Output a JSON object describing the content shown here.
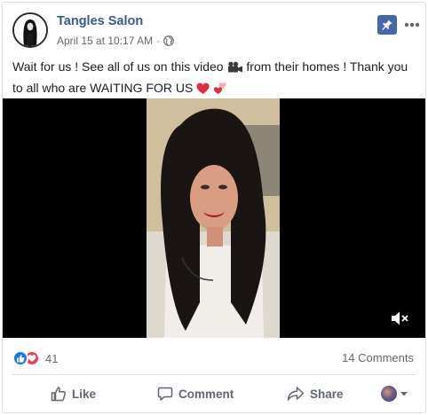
{
  "post": {
    "page_name": "Tangles Salon",
    "date": "April 15 at 10:17 AM",
    "separator": "·",
    "message": {
      "part1": "Wait for us ! See all of us on this video",
      "part2": "from their homes ! Thank you to all who are WAITING FOR US"
    }
  },
  "stats": {
    "reaction_count": "41",
    "comments": "14 Comments"
  },
  "actions": {
    "like": "Like",
    "comment": "Comment",
    "share": "Share"
  },
  "colors": {
    "brand": "#385898",
    "pin": "#4267b2",
    "like": "#1877f2",
    "love": "#f33e58"
  },
  "icons": [
    "pin-icon",
    "more-icon",
    "globe-icon",
    "video-camera-emoji",
    "heart-emoji",
    "hearts-emoji",
    "mute-icon",
    "like-reaction-icon",
    "love-reaction-icon",
    "thumbs-up-icon",
    "comment-icon",
    "share-icon",
    "chevron-down-icon"
  ]
}
